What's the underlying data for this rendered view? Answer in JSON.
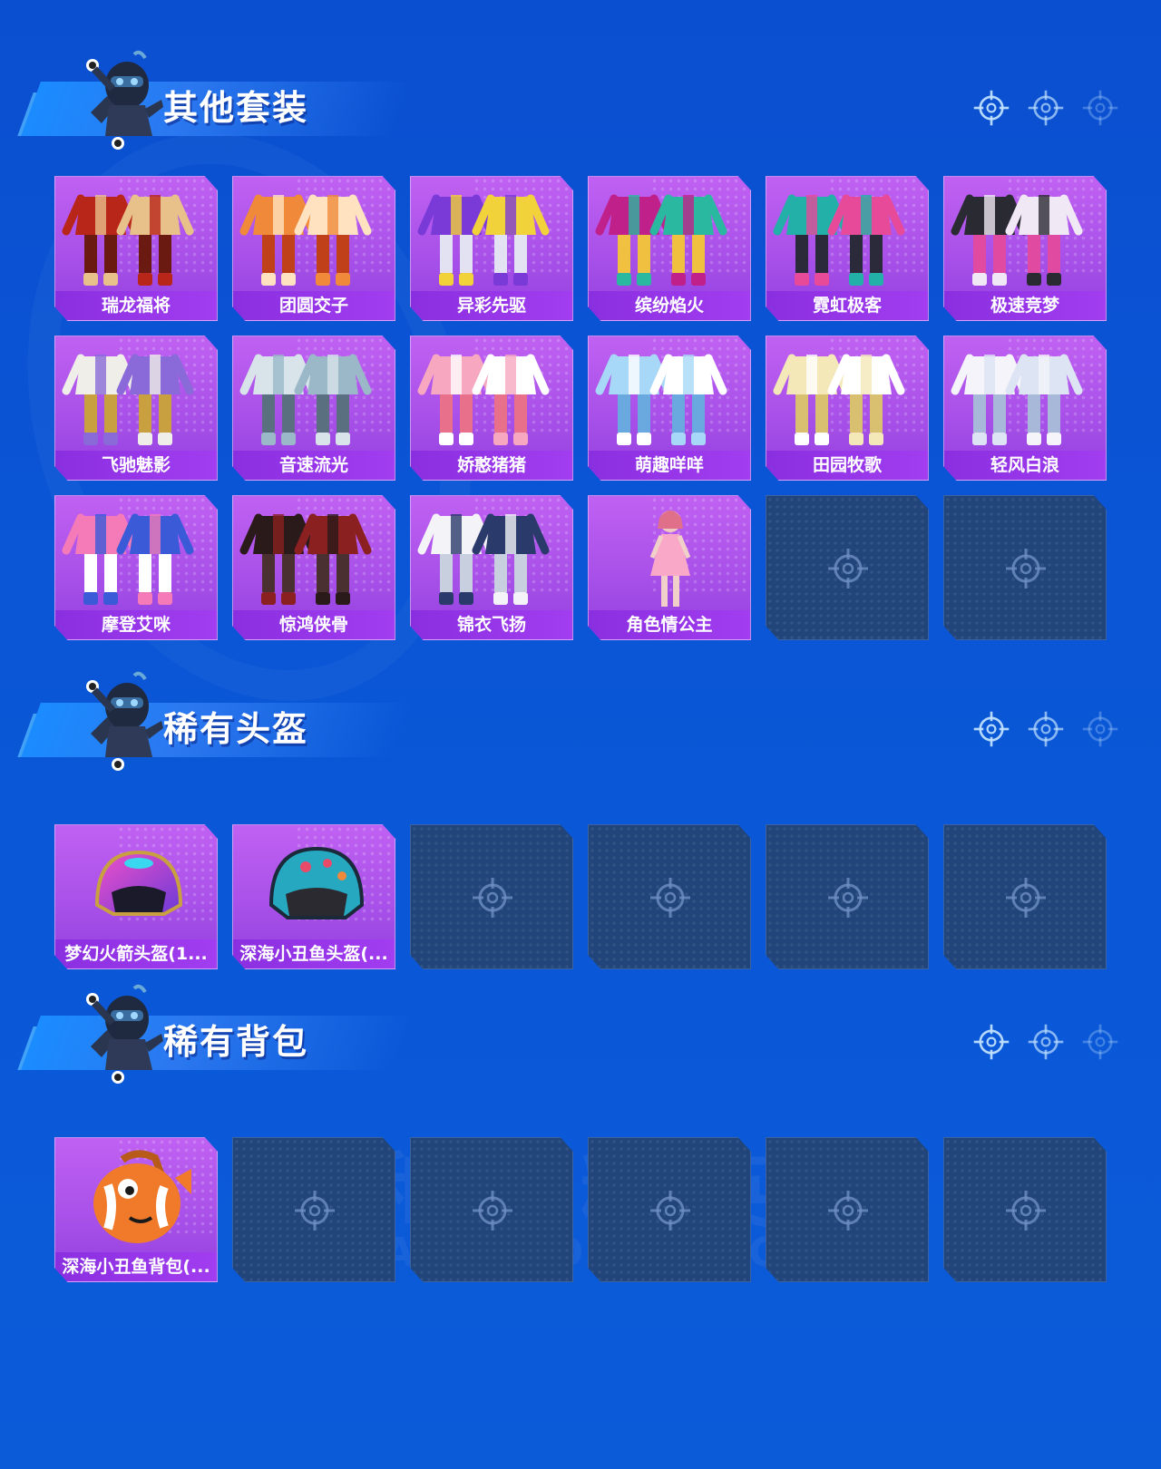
{
  "colors": {
    "background": "#0a56d6",
    "card_purple": "#a64fe8",
    "label_purple": "#8a2fe0",
    "empty_slot": "#21457a"
  },
  "watermark": {
    "top": "和平精英",
    "bottom": "GAME FOR PEACE"
  },
  "sections": [
    {
      "title": "其他套装",
      "items": [
        {
          "name": "瑞龙福将",
          "art": "outfit-red"
        },
        {
          "name": "团圆交子",
          "art": "outfit-orange"
        },
        {
          "name": "异彩先驱",
          "art": "outfit-purple-yellow"
        },
        {
          "name": "缤纷焰火",
          "art": "outfit-magenta-teal"
        },
        {
          "name": "霓虹极客",
          "art": "outfit-teal-pink"
        },
        {
          "name": "极速竞梦",
          "art": "outfit-black-pink"
        },
        {
          "name": "飞驰魅影",
          "art": "outfit-white-purple"
        },
        {
          "name": "音速流光",
          "art": "outfit-silver"
        },
        {
          "name": "娇憨猪猪",
          "art": "outfit-pink"
        },
        {
          "name": "萌趣咩咩",
          "art": "outfit-lightblue"
        },
        {
          "name": "田园牧歌",
          "art": "outfit-cream"
        },
        {
          "name": "轻风白浪",
          "art": "outfit-white"
        },
        {
          "name": "摩登艾咪",
          "art": "outfit-pink-blue"
        },
        {
          "name": "惊鸿侠骨",
          "art": "outfit-black-red"
        },
        {
          "name": "锦衣飞扬",
          "art": "outfit-white-navy"
        },
        {
          "name": "角色情公主",
          "art": "character-pink-dress"
        }
      ],
      "empty_slots": 2
    },
    {
      "title": "稀有头盔",
      "items": [
        {
          "name": "梦幻火箭头盔(1...",
          "art": "helmet-pink-purple"
        },
        {
          "name": "深海小丑鱼头盔(...",
          "art": "helmet-teal"
        }
      ],
      "empty_slots": 4
    },
    {
      "title": "稀有背包",
      "items": [
        {
          "name": "深海小丑鱼背包(...",
          "art": "backpack-clownfish"
        }
      ],
      "empty_slots": 5
    }
  ]
}
